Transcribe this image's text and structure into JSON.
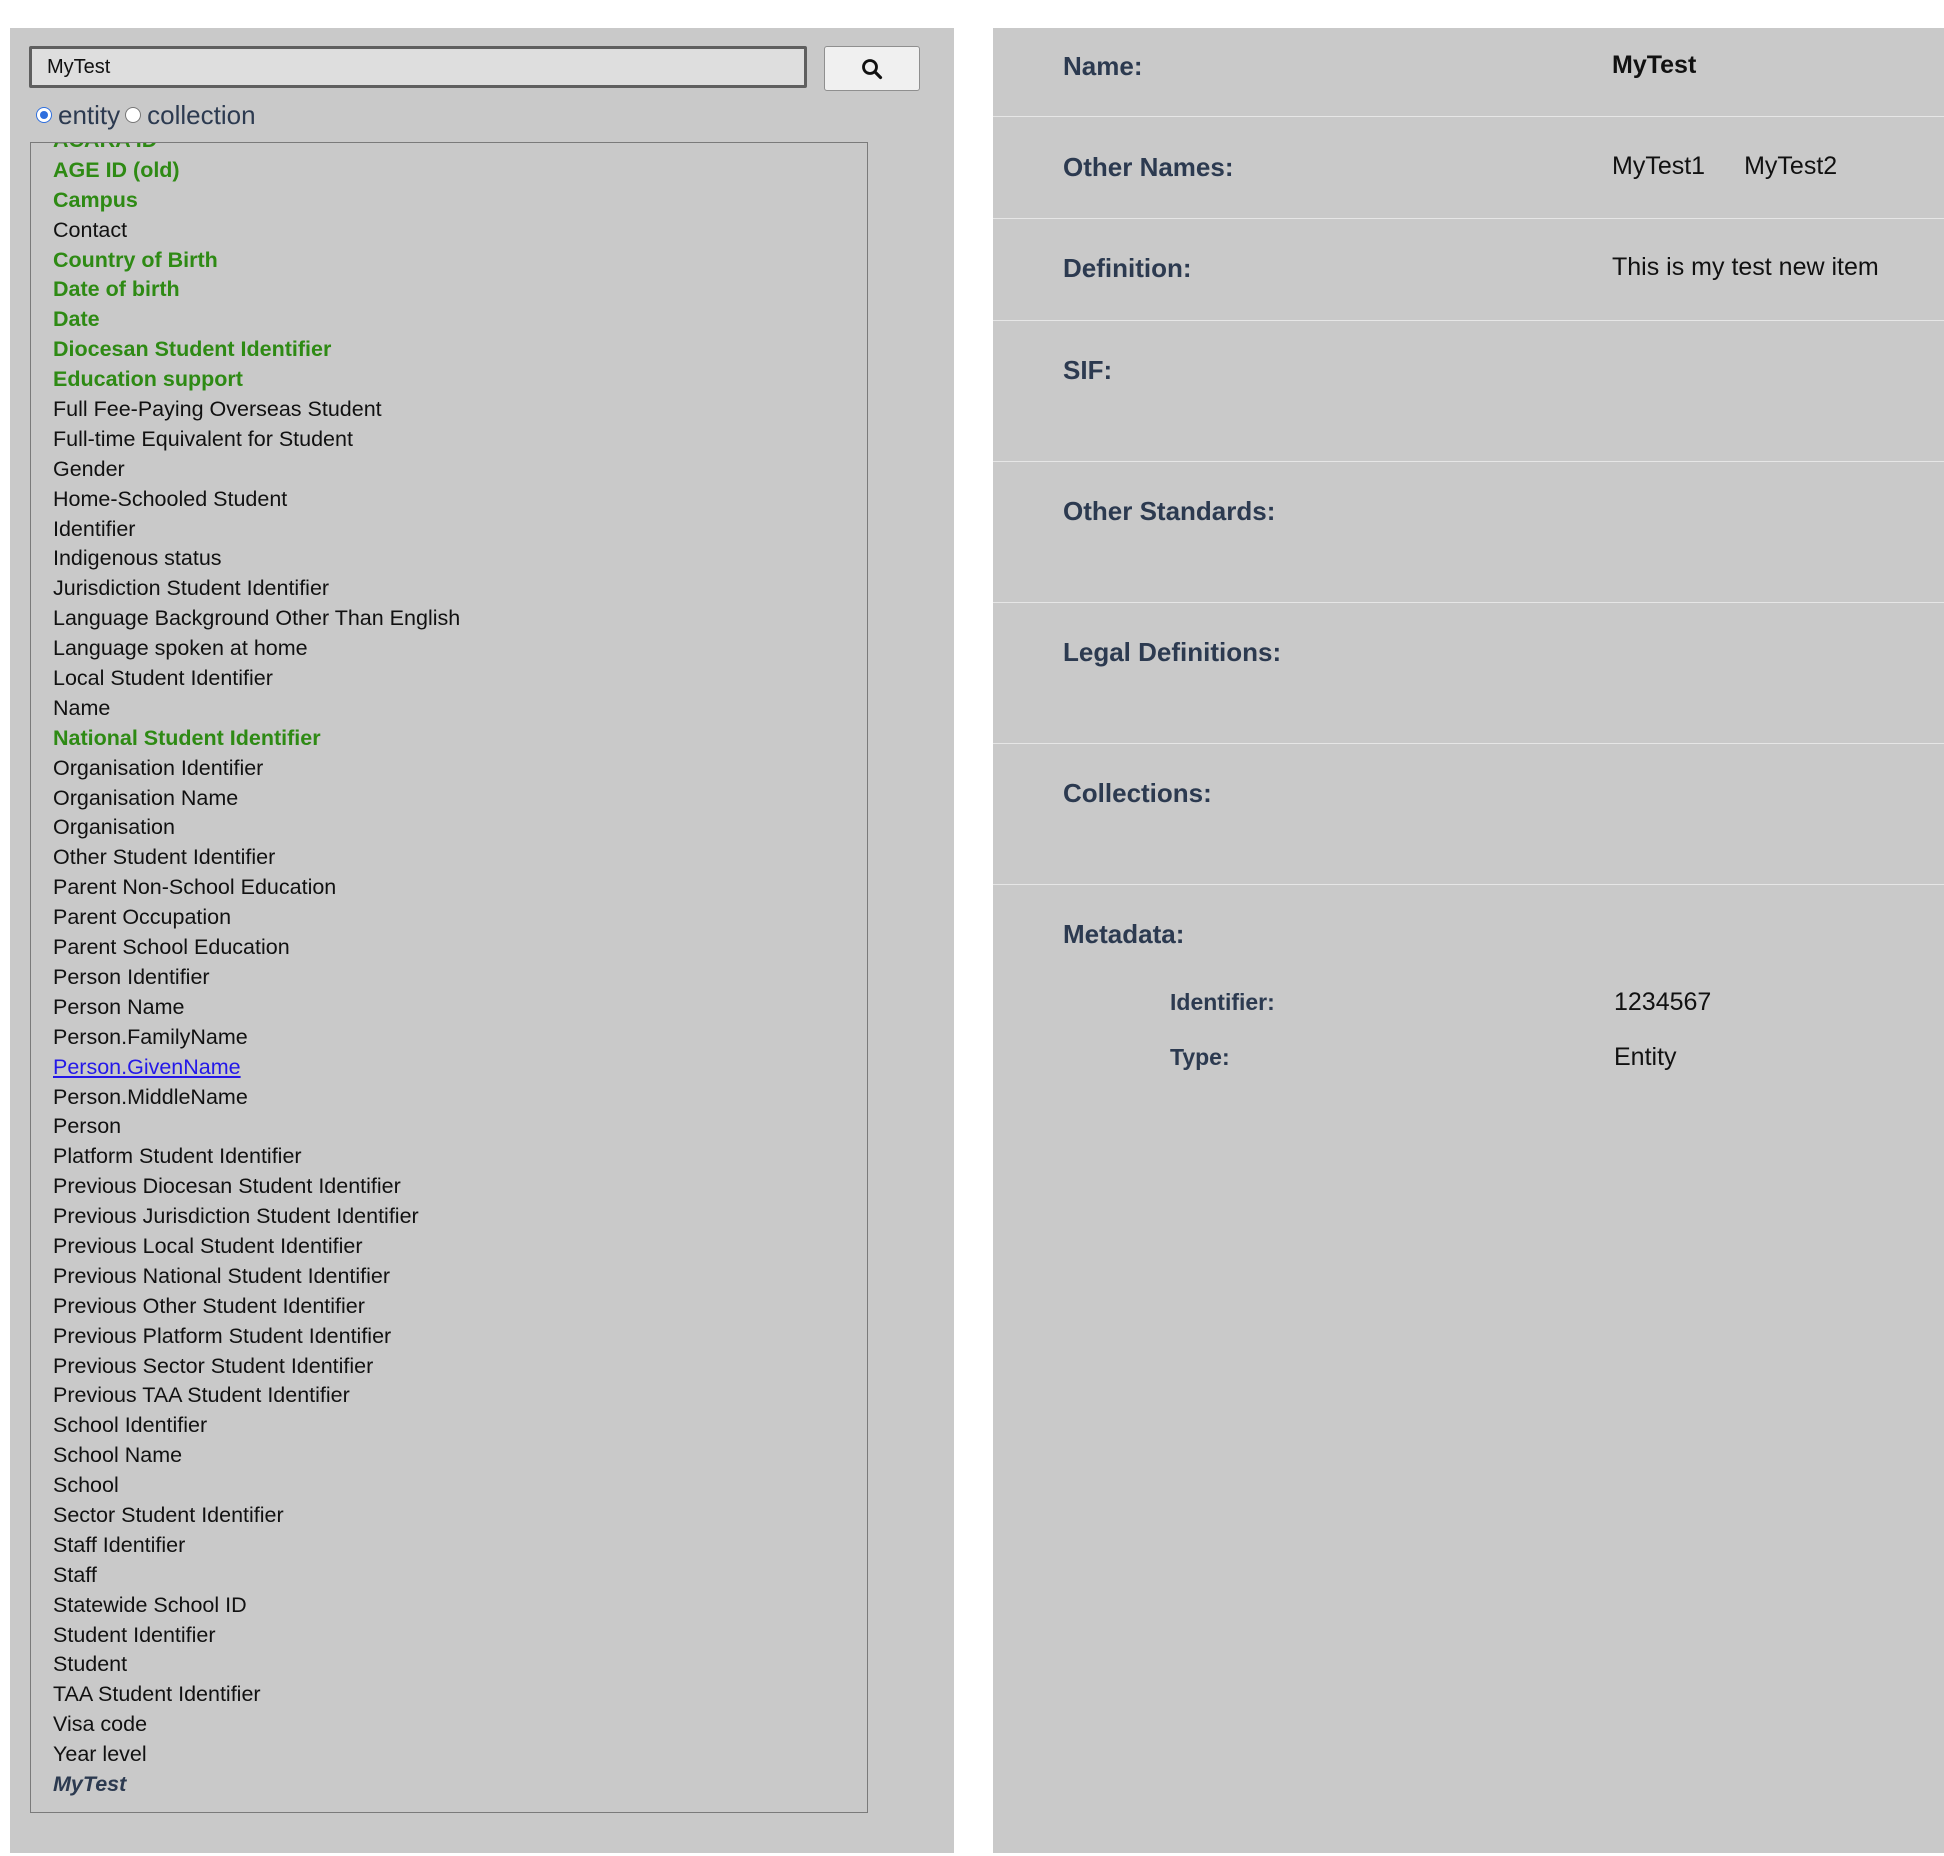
{
  "search": {
    "query": "MyTest",
    "button_icon": "search-icon"
  },
  "filter": {
    "options": [
      {
        "label": "entity",
        "checked": true
      },
      {
        "label": "collection",
        "checked": false
      }
    ]
  },
  "list": {
    "items": [
      {
        "label": "ACARA ID",
        "style": "highlight"
      },
      {
        "label": "AGE ID (old)",
        "style": "highlight"
      },
      {
        "label": "Campus",
        "style": "highlight"
      },
      {
        "label": "Contact",
        "style": "normal"
      },
      {
        "label": "Country of Birth",
        "style": "highlight"
      },
      {
        "label": "Date of birth",
        "style": "highlight"
      },
      {
        "label": "Date",
        "style": "highlight"
      },
      {
        "label": "Diocesan Student Identifier",
        "style": "highlight"
      },
      {
        "label": "Education support",
        "style": "highlight"
      },
      {
        "label": "Full Fee-Paying Overseas Student",
        "style": "normal"
      },
      {
        "label": "Full-time Equivalent for Student",
        "style": "normal"
      },
      {
        "label": "Gender",
        "style": "normal"
      },
      {
        "label": "Home-Schooled Student",
        "style": "normal"
      },
      {
        "label": "Identifier",
        "style": "normal"
      },
      {
        "label": "Indigenous status",
        "style": "normal"
      },
      {
        "label": "Jurisdiction Student Identifier",
        "style": "normal"
      },
      {
        "label": "Language Background Other Than English",
        "style": "normal"
      },
      {
        "label": "Language spoken at home",
        "style": "normal"
      },
      {
        "label": "Local Student Identifier",
        "style": "normal"
      },
      {
        "label": "Name",
        "style": "normal"
      },
      {
        "label": "National Student Identifier",
        "style": "highlight"
      },
      {
        "label": "Organisation Identifier",
        "style": "normal"
      },
      {
        "label": "Organisation Name",
        "style": "normal"
      },
      {
        "label": "Organisation",
        "style": "normal"
      },
      {
        "label": "Other Student Identifier",
        "style": "normal"
      },
      {
        "label": "Parent Non-School Education",
        "style": "normal"
      },
      {
        "label": "Parent Occupation",
        "style": "normal"
      },
      {
        "label": "Parent School Education",
        "style": "normal"
      },
      {
        "label": "Person Identifier",
        "style": "normal"
      },
      {
        "label": "Person Name",
        "style": "normal"
      },
      {
        "label": "Person.FamilyName",
        "style": "normal"
      },
      {
        "label": "Person.GivenName",
        "style": "selected"
      },
      {
        "label": "Person.MiddleName",
        "style": "normal"
      },
      {
        "label": "Person",
        "style": "normal"
      },
      {
        "label": "Platform Student Identifier",
        "style": "normal"
      },
      {
        "label": "Previous Diocesan Student Identifier",
        "style": "normal"
      },
      {
        "label": "Previous Jurisdiction Student Identifier",
        "style": "normal"
      },
      {
        "label": "Previous Local Student Identifier",
        "style": "normal"
      },
      {
        "label": "Previous National Student Identifier",
        "style": "normal"
      },
      {
        "label": "Previous Other Student Identifier",
        "style": "normal"
      },
      {
        "label": "Previous Platform Student Identifier",
        "style": "normal"
      },
      {
        "label": "Previous Sector Student Identifier",
        "style": "normal"
      },
      {
        "label": "Previous TAA Student Identifier",
        "style": "normal"
      },
      {
        "label": "School Identifier",
        "style": "normal"
      },
      {
        "label": "School Name",
        "style": "normal"
      },
      {
        "label": "School",
        "style": "normal"
      },
      {
        "label": "Sector Student Identifier",
        "style": "normal"
      },
      {
        "label": "Staff Identifier",
        "style": "normal"
      },
      {
        "label": "Staff",
        "style": "normal"
      },
      {
        "label": "Statewide School ID",
        "style": "normal"
      },
      {
        "label": "Student Identifier",
        "style": "normal"
      },
      {
        "label": "Student",
        "style": "normal"
      },
      {
        "label": "TAA Student Identifier",
        "style": "normal"
      },
      {
        "label": "Visa code",
        "style": "normal"
      },
      {
        "label": "Year level",
        "style": "normal"
      },
      {
        "label": "MyTest",
        "style": "new-item"
      }
    ]
  },
  "detail": {
    "name": {
      "label": "Name:",
      "value": "MyTest"
    },
    "other_names": {
      "label": "Other Names:",
      "values": [
        "MyTest1",
        "MyTest2"
      ]
    },
    "definition": {
      "label": "Definition:",
      "value": "This is my test new item"
    },
    "sif": {
      "label": "SIF:"
    },
    "other_standards": {
      "label": "Other Standards:"
    },
    "legal_definitions": {
      "label": "Legal Definitions:"
    },
    "collections": {
      "label": "Collections:"
    },
    "metadata": {
      "label": "Metadata:",
      "identifier": {
        "label": "Identifier:",
        "value": "1234567"
      },
      "type": {
        "label": "Type:",
        "value": "Entity"
      }
    }
  },
  "colors": {
    "panel_bg": "#c9c9c9",
    "highlight_text": "#2e8a14",
    "selected_link": "#2418e8",
    "label_text": "#2c3a50"
  }
}
